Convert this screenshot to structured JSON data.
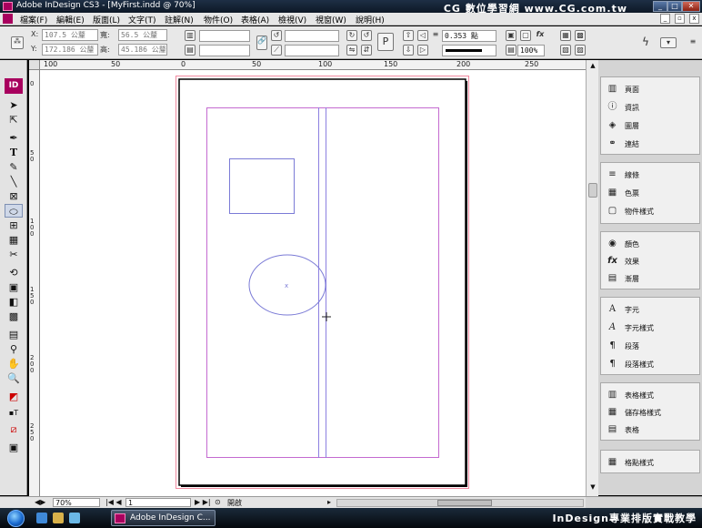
{
  "window": {
    "title": "Adobe InDesign CS3 - [MyFirst.indd @ 70%]",
    "watermark": "CG 數位學習網 www.CG.com.tw",
    "btn_min": "_",
    "btn_max": "□",
    "btn_close": "✕"
  },
  "menu": {
    "items": [
      "檔案(F)",
      "編輯(E)",
      "版面(L)",
      "文字(T)",
      "註解(N)",
      "物件(O)",
      "表格(A)",
      "檢視(V)",
      "視窗(W)",
      "說明(H)"
    ]
  },
  "control": {
    "x_label": "X:",
    "y_label": "Y:",
    "w_label": "寬:",
    "h_label": "高:",
    "x_value": "107.5 公釐",
    "y_value": "172.186 公釐",
    "w_value": "56.5 公釐",
    "h_value": "45.186 公釐",
    "stroke_weight": "0.353 點",
    "zoom_field": "100%"
  },
  "ruler": {
    "h_ticks": [
      "100",
      "50",
      "0",
      "50",
      "100",
      "150",
      "200",
      "250"
    ],
    "v_ticks": [
      "0",
      "50",
      "100",
      "150",
      "200",
      "250"
    ]
  },
  "panel": {
    "group1": [
      "頁面",
      "資訊",
      "圖層",
      "連結"
    ],
    "group2": [
      "線條",
      "色票",
      "物件樣式"
    ],
    "group3": [
      "顏色",
      "效果",
      "漸層"
    ],
    "group4": [
      "字元",
      "字元樣式",
      "段落",
      "段落樣式"
    ],
    "group5": [
      "表格樣式",
      "儲存格樣式",
      "表格"
    ],
    "group6": [
      "格點樣式"
    ]
  },
  "status": {
    "zoom": "70%",
    "page": "1",
    "mode": "開啟"
  },
  "taskbar": {
    "app_label": "Adobe InDesign C...",
    "caption": "InDesign專業排版實戰教學"
  },
  "colors": {
    "margin_guide": "#c46ad0",
    "column_guide": "#8c7fe0",
    "bleed_guide": "#f08aa0",
    "selection": "#7b7bd6"
  }
}
